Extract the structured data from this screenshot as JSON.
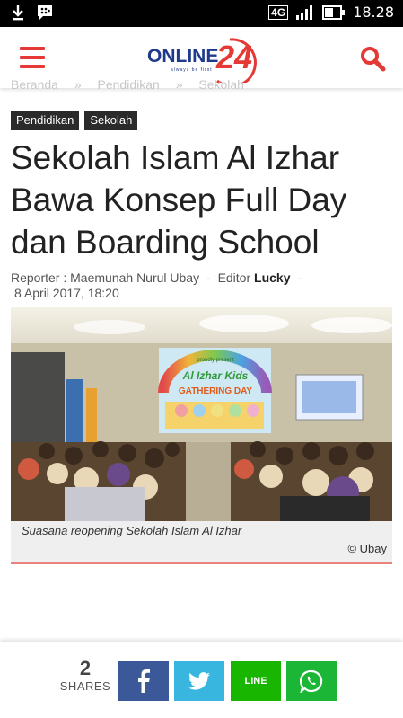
{
  "status_bar": {
    "network": "4G",
    "time": "18.28",
    "icons": [
      "download-icon",
      "bbm-icon",
      "signal-icon",
      "battery-icon"
    ]
  },
  "header": {
    "logo_text": "ONLINE24",
    "logo_tagline": "always be first",
    "brand_color": "#e53935",
    "logo_blue": "#1f3a8a"
  },
  "breadcrumb": [
    "Beranda",
    "Pendidikan",
    "Sekolah"
  ],
  "tags": [
    "Pendidikan",
    "Sekolah"
  ],
  "article": {
    "title": "Sekolah Islam Al Izhar Bawa Konsep Full Day dan Boarding School",
    "reporter_label": "Reporter : Maemunah Nurul Ubay",
    "editor_label": "Editor",
    "editor_name": "Lucky",
    "date": "8 April 2017, 18:20"
  },
  "photo": {
    "banner_line1": "proudly present",
    "banner_line2": "Al Izhar Kids",
    "banner_line3": "GATHERING DAY",
    "caption": "Suasana reopening Sekolah Islam Al Izhar",
    "credit": "© Ubay"
  },
  "share": {
    "count": "2",
    "label": "SHARES",
    "line_label": "LINE",
    "colors": {
      "facebook": "#3b5998",
      "twitter": "#38b6e0",
      "line": "#19b600",
      "whatsapp": "#1bb636"
    }
  }
}
